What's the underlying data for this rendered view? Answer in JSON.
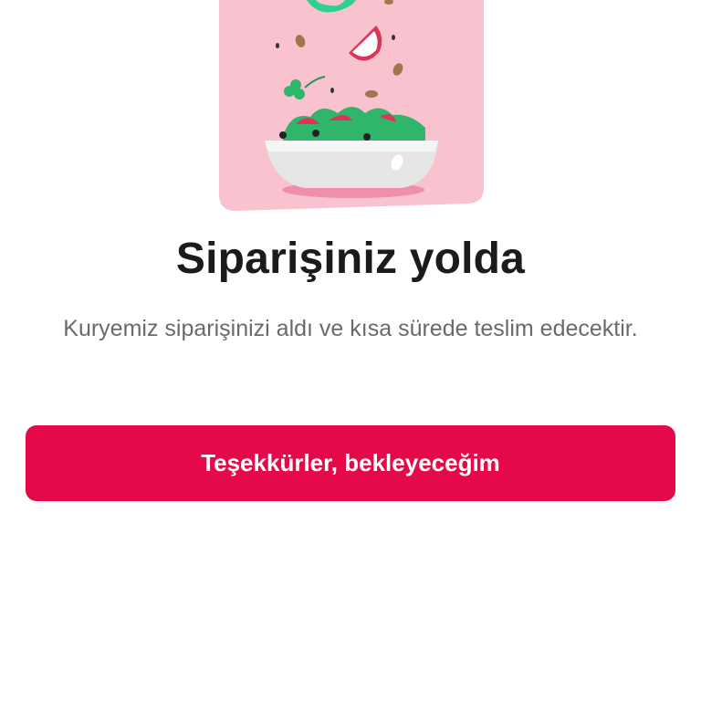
{
  "status": {
    "illustration_icon": "salad-bowl-illustration",
    "title": "Siparişiniz yolda",
    "subtitle": "Kuryemiz siparişinizi aldı ve kısa sürede teslim edecektir."
  },
  "actions": {
    "confirm_label": "Teşekkürler, bekleyeceğim"
  },
  "colors": {
    "accent": "#e5094a",
    "card_background": "#f8c3cf",
    "title_text": "#1b1b1b",
    "body_text": "#6a6a6a"
  }
}
